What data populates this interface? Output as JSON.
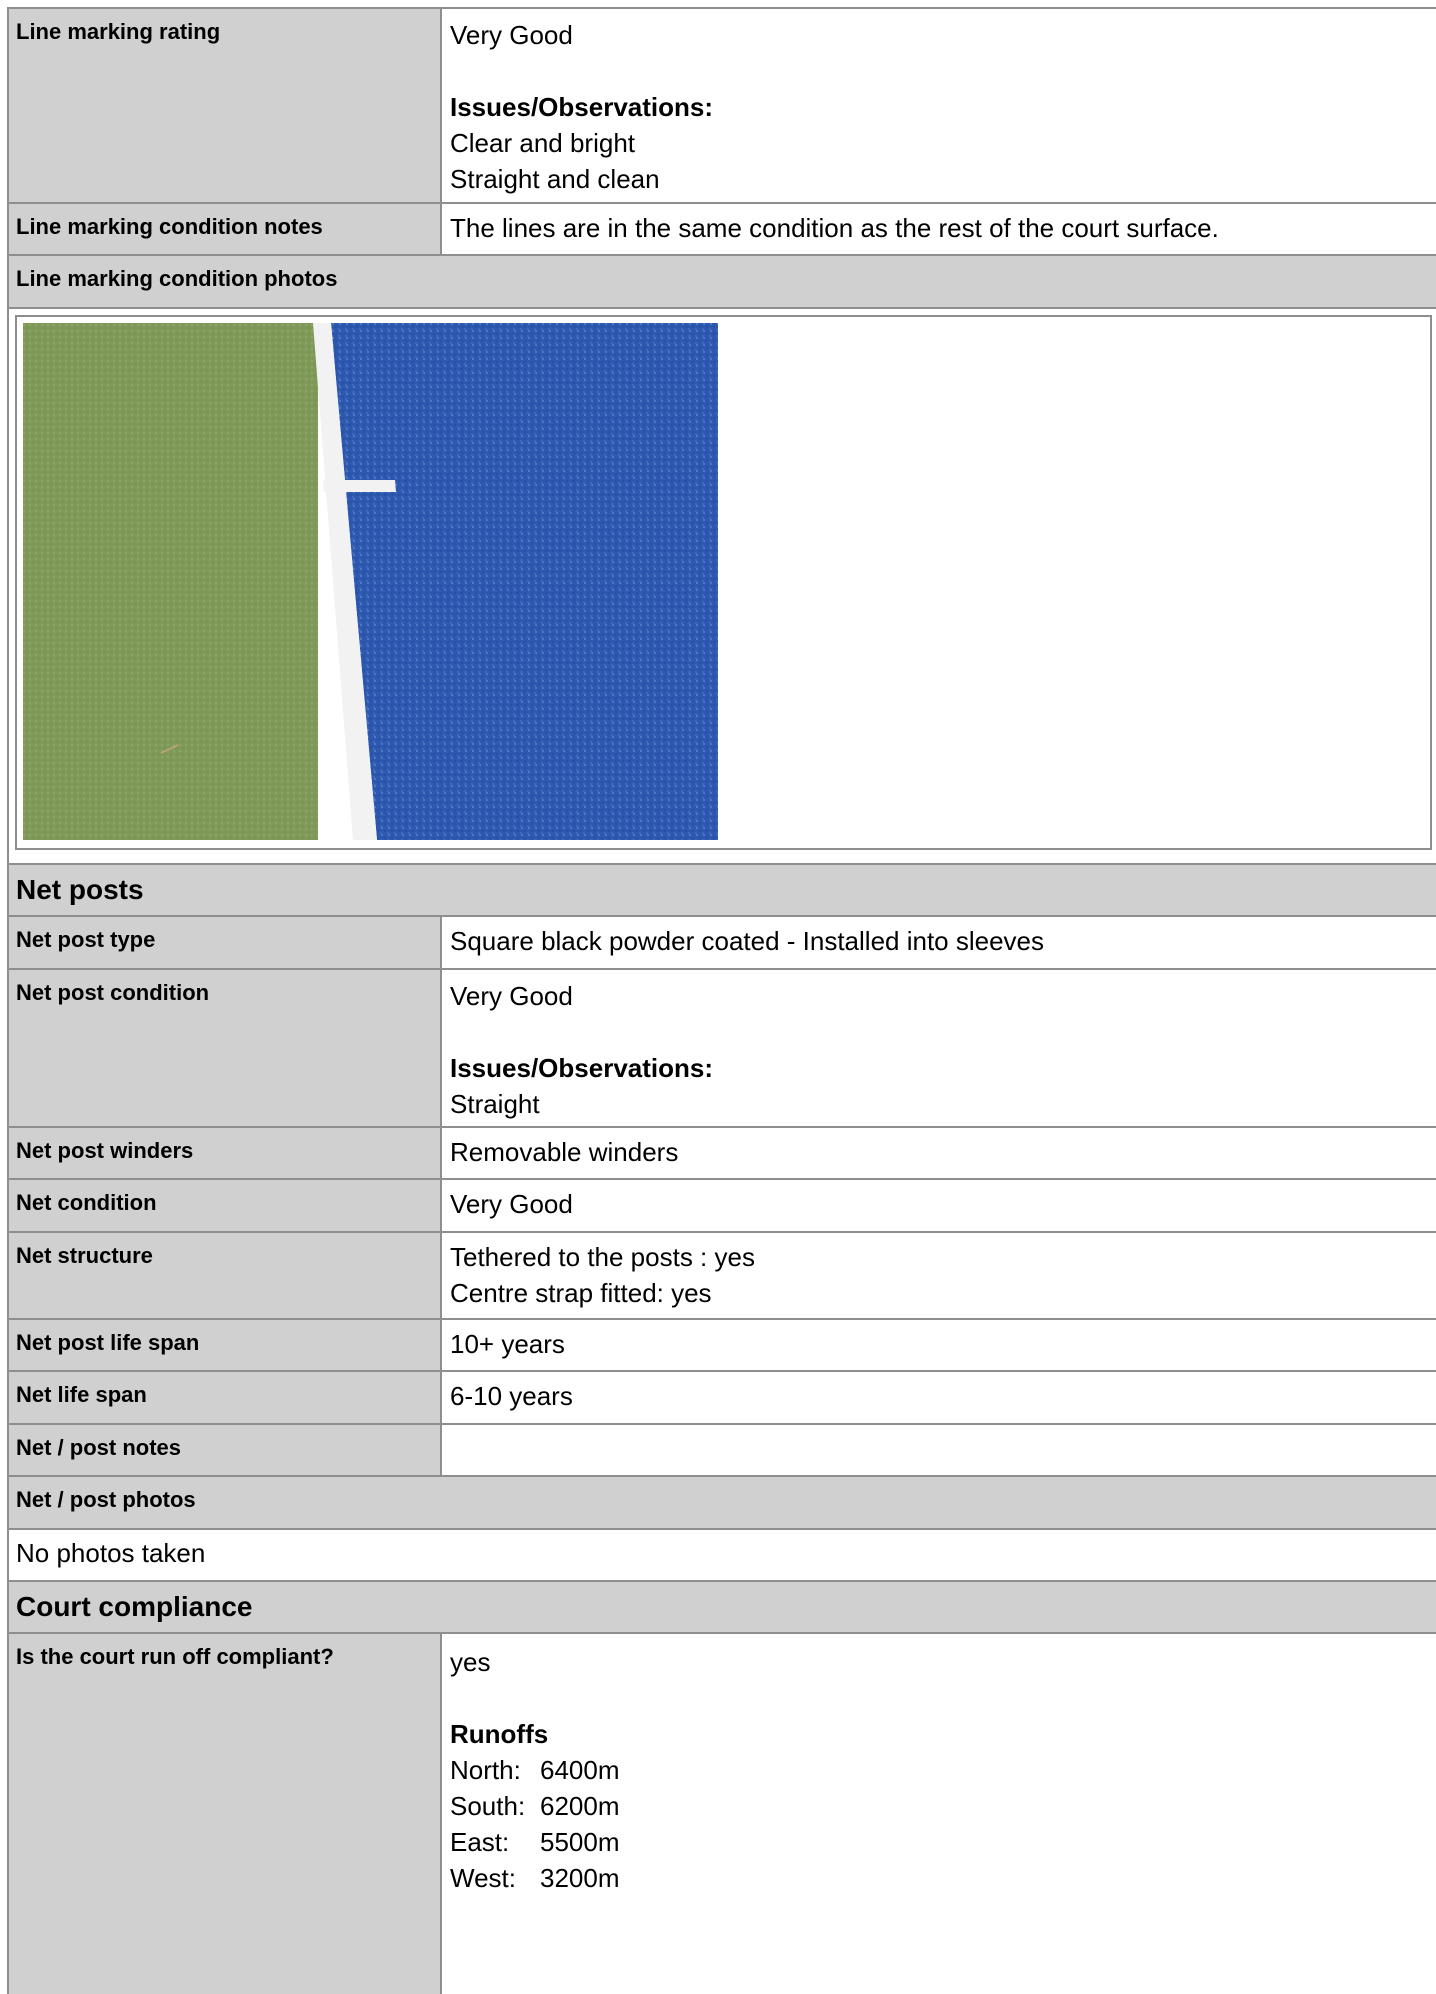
{
  "rows1": [
    {
      "label": "Line marking rating"
    },
    {
      "label": "Line marking condition notes"
    }
  ],
  "line_marking": {
    "rating_value": "Very Good",
    "issues_heading": "Issues/Observations:",
    "issues": [
      "Clear and bright",
      "Straight and clean"
    ],
    "notes_value": "The lines are in the same condition as the rest of the court surface.",
    "photos_label": "Line marking condition photos"
  },
  "net_posts": {
    "section_title": "Net posts",
    "type_label": "Net post type",
    "type_value": "Square black powder coated - Installed into sleeves",
    "condition_label": "Net post condition",
    "condition_value": "Very Good",
    "issues_heading": "Issues/Observations:",
    "issues": [
      "Straight"
    ],
    "winders_label": "Net post winders",
    "winders_value": "Removable winders",
    "net_condition_label": "Net condition",
    "net_condition_value": "Very Good",
    "structure_label": "Net structure",
    "structure_lines": [
      "Tethered to the posts : yes",
      "Centre strap fitted: yes"
    ],
    "post_life_label": "Net post life span",
    "post_life_value": "10+ years",
    "net_life_label": "Net life span",
    "net_life_value": "6-10 years",
    "notes_label": "Net / post notes",
    "notes_value": "",
    "photos_label": "Net / post photos",
    "photos_value": "No photos taken"
  },
  "compliance": {
    "section_title": "Court compliance",
    "runoff_label": "Is the court run off compliant?",
    "runoff_value": "yes",
    "runoffs_heading": "Runoffs",
    "runoffs": [
      {
        "dir": "North:",
        "value": "6400m"
      },
      {
        "dir": "South:",
        "value": "6200m"
      },
      {
        "dir": "East:",
        "value": "5500m"
      },
      {
        "dir": "West:",
        "value": "3200m"
      }
    ]
  },
  "colors": {
    "header_gray": "#d0d0d0",
    "border_gray": "#8e8e8e",
    "court_green": "#7f9a58",
    "court_blue": "#2c58b0",
    "line_white": "#f2f2f2"
  }
}
